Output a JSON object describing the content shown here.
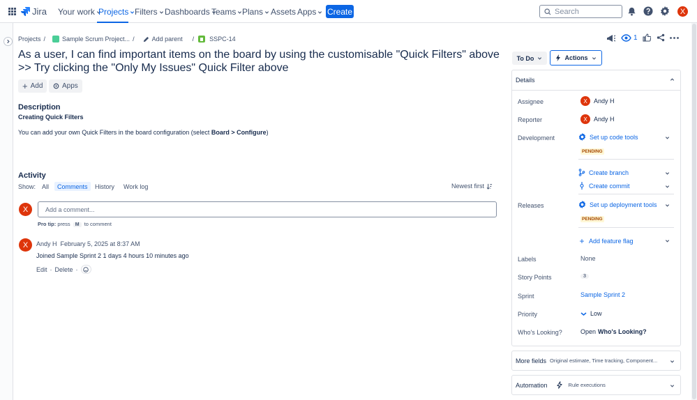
{
  "nav": {
    "brand": "Jira",
    "items": [
      "Your work",
      "Projects",
      "Filters",
      "Dashboards",
      "Teams",
      "Plans",
      "Assets",
      "Apps"
    ],
    "create_label": "Create",
    "search_placeholder": "Search",
    "user_initial": "X"
  },
  "breadcrumb": {
    "projects": "Projects",
    "project": "Sample Scrum Project...",
    "add_parent": "Add parent",
    "issue_key": "SSPC-14"
  },
  "issue": {
    "title": "As a user, I can find important items on the board by using the customisable \"Quick Filters\" above >> Try clicking the \"Only My Issues\" Quick Filter above",
    "add_label": "Add",
    "apps_label": "Apps",
    "watch_count": "1"
  },
  "description": {
    "heading": "Description",
    "subheading": "Creating Quick Filters",
    "text_before": "You can add your own Quick Filters in the board configuration (select ",
    "text_bold": "Board > Configure",
    "text_after": ")"
  },
  "activity": {
    "heading": "Activity",
    "show_label": "Show:",
    "tabs": [
      "All",
      "Comments",
      "History",
      "Work log"
    ],
    "sort_label": "Newest first",
    "comment_placeholder": "Add a comment...",
    "pro_tip_label": "Pro tip:",
    "pro_tip_press": "press",
    "pro_tip_key": "M",
    "pro_tip_rest": "to comment",
    "entry": {
      "author": "Andy H",
      "date": "February 5, 2025 at 8:37 AM",
      "text": "Joined Sample Sprint 2 1 days 4 hours 10 minutes ago",
      "edit": "Edit",
      "delete": "Delete"
    }
  },
  "status": {
    "label": "To Do",
    "actions_label": "Actions"
  },
  "details": {
    "heading": "Details",
    "assignee_label": "Assignee",
    "assignee": "Andy H",
    "reporter_label": "Reporter",
    "reporter": "Andy H",
    "development_label": "Development",
    "setup_code_tools": "Set up code tools",
    "pending": "PENDING",
    "create_branch": "Create branch",
    "create_commit": "Create commit",
    "releases_label": "Releases",
    "setup_deploy_tools": "Set up deployment tools",
    "add_feature_flag": "Add feature flag",
    "labels_label": "Labels",
    "labels_value": "None",
    "story_points_label": "Story Points",
    "story_points": "3",
    "sprint_label": "Sprint",
    "sprint_value": "Sample Sprint 2",
    "priority_label": "Priority",
    "priority_value": "Low",
    "whos_looking_label": "Who's Looking?",
    "whos_looking_open": "Open",
    "whos_looking_bold": "Who's Looking?"
  },
  "more_fields": {
    "label": "More fields",
    "sub": "Original estimate, Time tracking, Component..."
  },
  "automation": {
    "label": "Automation",
    "sub": "Rule executions"
  },
  "colors": {
    "brand_blue": "#0c66e4",
    "avatar_red": "#de350b"
  }
}
